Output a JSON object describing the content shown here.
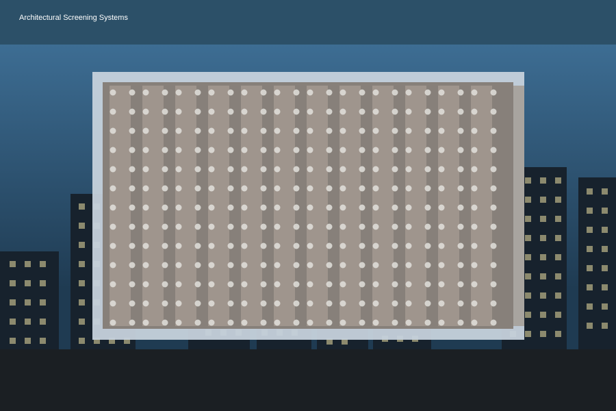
{
  "header": {
    "title": "Architectural Screening Systems"
  },
  "colors": {
    "header_bg": "#2c5068",
    "sky_top": "#3d6d93",
    "sky_bottom": "#1f3b52",
    "ground": "#1b1f23",
    "building": "#17222d",
    "window": "#8c8a6e",
    "frame": "#c6d2dc",
    "panel_bg": "#87807a",
    "strip": "#9f958d",
    "dot": "#e2e0dc"
  },
  "panel": {
    "columns": 12,
    "dot_rows": 13
  }
}
